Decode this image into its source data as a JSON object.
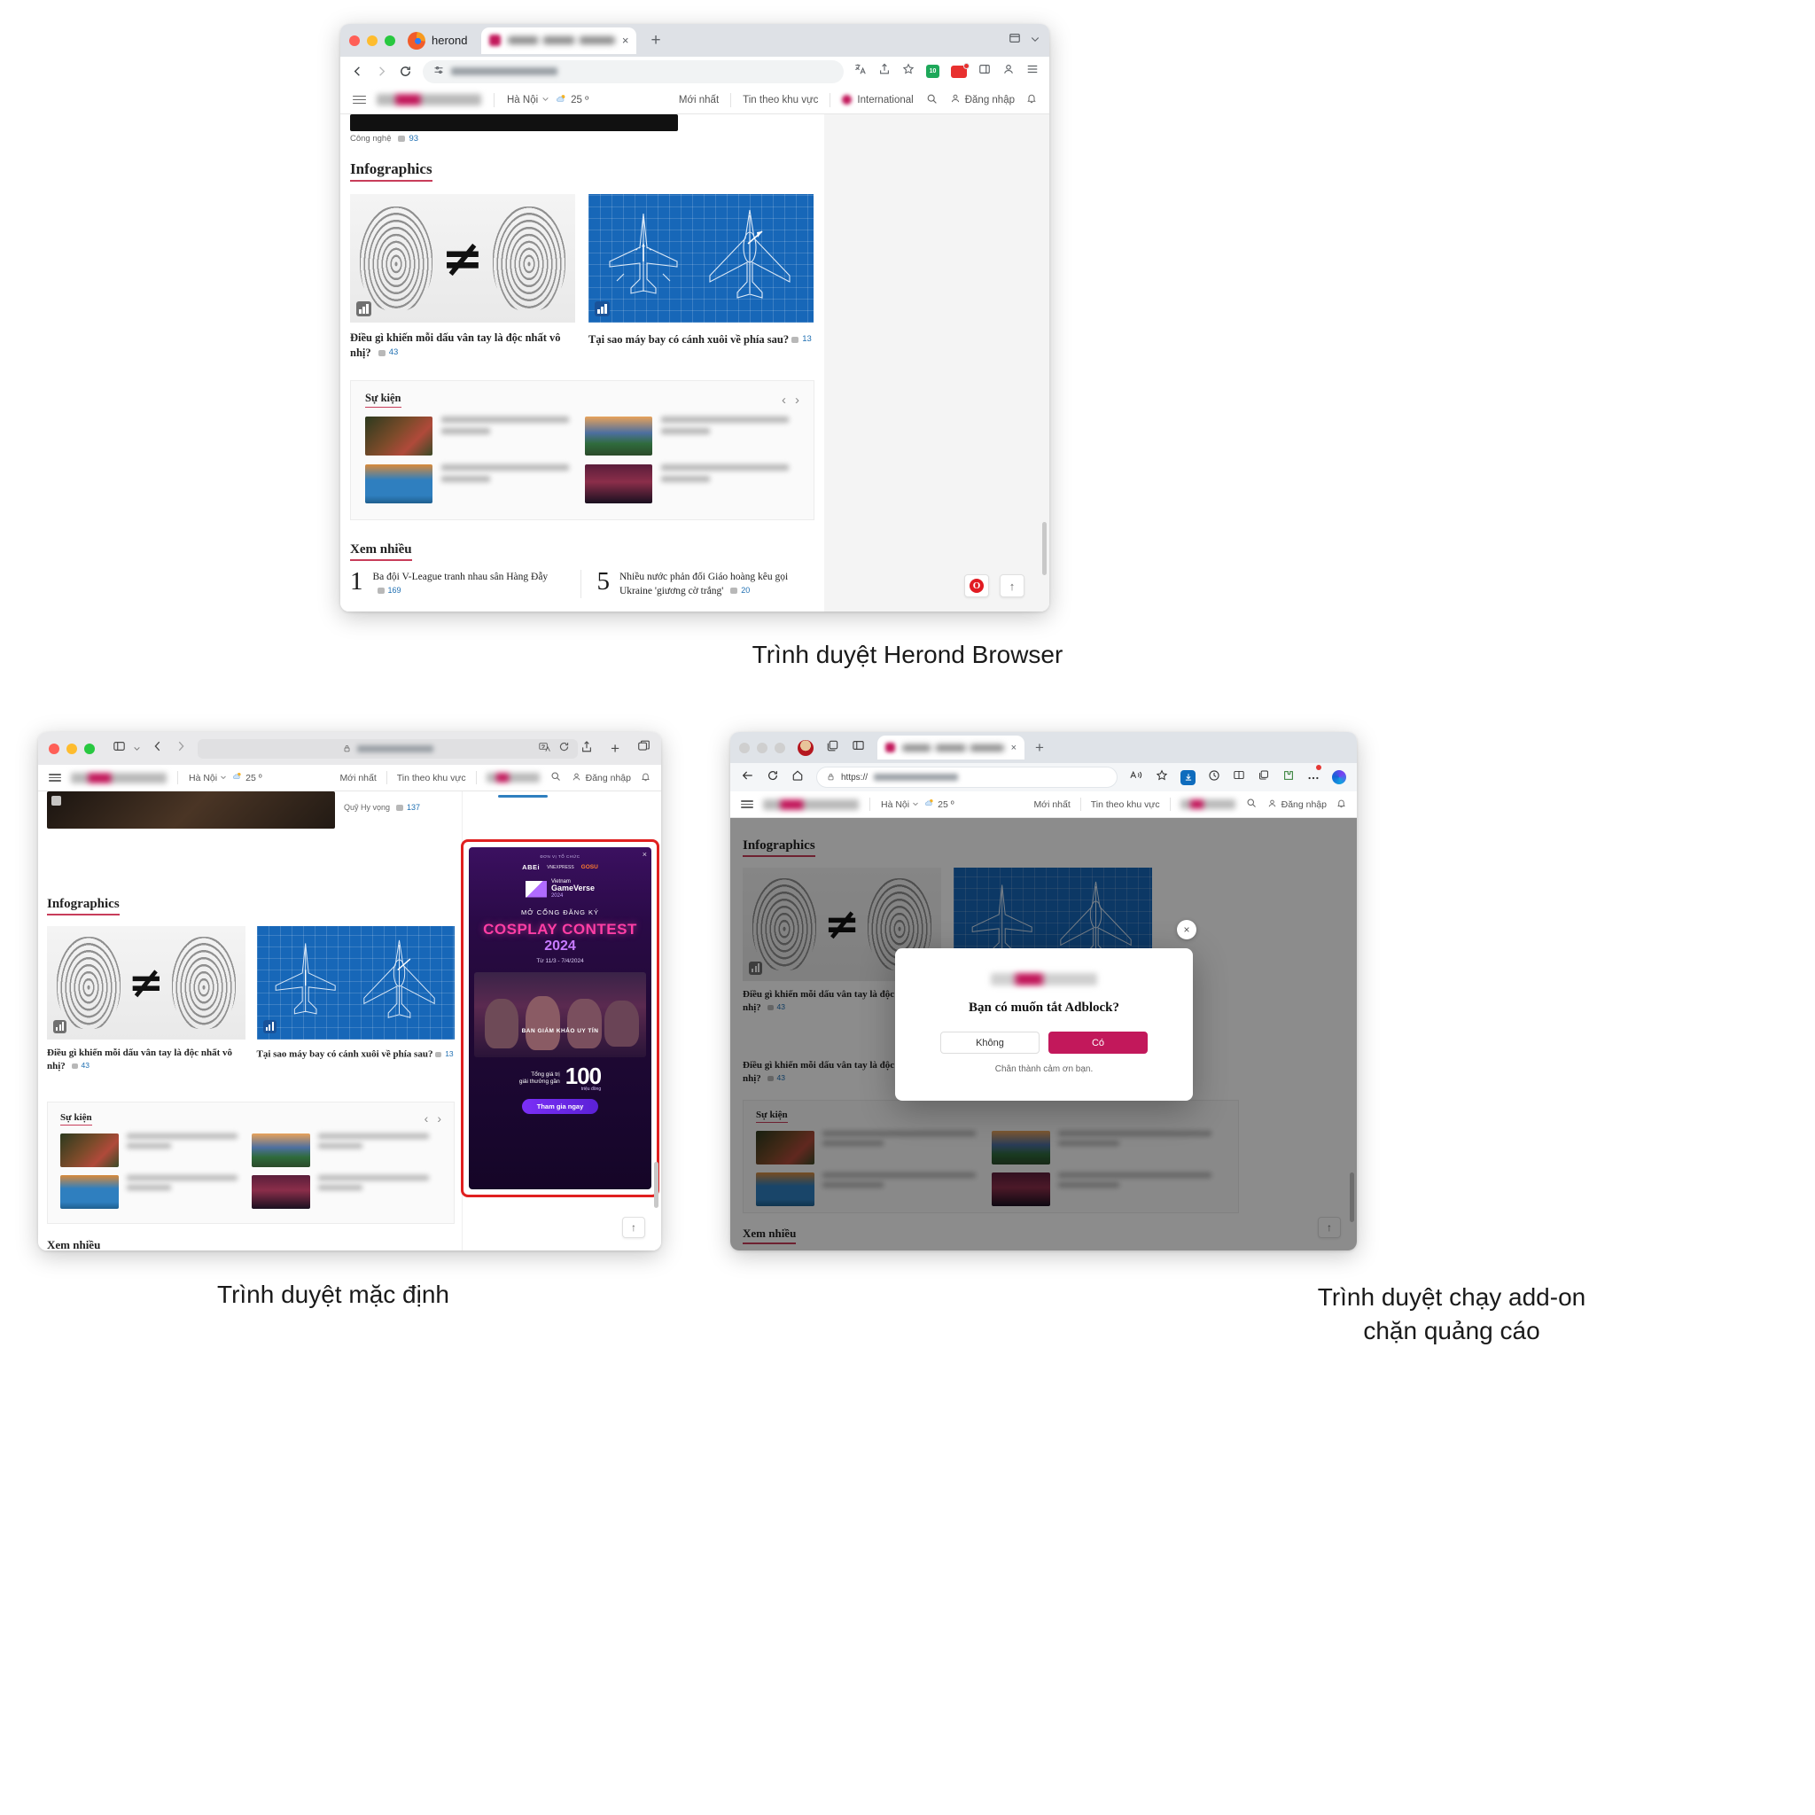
{
  "captions": {
    "top": "Trình duyệt Herond Browser",
    "bottom_left": "Trình duyệt mặc định",
    "bottom_right_line1": "Trình duyệt chạy add-on",
    "bottom_right_line2": "chặn quảng cáo"
  },
  "colors": {
    "accent_red": "#c83d5a",
    "brand_pink": "#c2185b",
    "link_blue": "#1f6fb2",
    "blueprint": "#1767b8",
    "ad_highlight": "#e02020",
    "opera_red": "#e11b22"
  },
  "browser_herond": {
    "brand_label": "herond",
    "tab_title": "",
    "tab_close": "×",
    "new_tab": "+",
    "nav": {
      "back": "←",
      "forward": "→",
      "reload": "⟳",
      "site_settings": "⚙"
    },
    "url": "",
    "toolbar_icons": [
      "translate-icon",
      "share-icon",
      "bookmark-star-icon",
      "shield-counter-icon",
      "extensions-icon",
      "sidebar-icon",
      "profile-icon",
      "menu-icon"
    ],
    "shield_count": "10",
    "window_controls": [
      "close",
      "minimize",
      "zoom"
    ]
  },
  "site": {
    "location": "Hà Nội",
    "temperature": "25 º",
    "nav_links": [
      "Mới nhất",
      "Tin theo khu vực"
    ],
    "international_label": "International",
    "login_label": "Đăng nhập",
    "search_icon": "search-icon",
    "bell_icon": "bell-icon",
    "top_snippet_category": "Công nghệ",
    "top_snippet_comments": "93",
    "quy_hy_vong_label": "Quỹ Hy vọng",
    "quy_hy_vong_comments": "137",
    "infographics": {
      "heading": "Infographics",
      "cards": [
        {
          "title": "Điều gì khiến mỗi dấu vân tay là độc nhất vô nhị?",
          "comments": "43",
          "art": "fingerprint"
        },
        {
          "title": "Tại sao máy bay có cánh xuôi về phía sau?",
          "comments": "13",
          "art": "blueprint-jet"
        }
      ]
    },
    "events": {
      "heading": "Sự kiện",
      "prev": "‹",
      "next": "›",
      "items": [
        {
          "thumb": "crowd-marathon",
          "lines": 2
        },
        {
          "thumb": "golden-bridge",
          "lines": 2
        },
        {
          "thumb": "runners-blue",
          "lines": 2
        },
        {
          "thumb": "stage-event",
          "lines": 2
        }
      ]
    },
    "most_read": {
      "heading": "Xem nhiều",
      "items": [
        {
          "rank": "1",
          "title": "Ba đội V-League tranh nhau sân Hàng Đẫy",
          "comments": "169"
        },
        {
          "rank": "5",
          "title": "Nhiều nước phản đối Giáo hoàng kêu gọi Ukraine 'giương cờ trắng'",
          "comments": "20"
        }
      ]
    },
    "back_to_top": "↑"
  },
  "browser_safari": {
    "window_controls": [
      "close",
      "minimize",
      "zoom"
    ],
    "sidebar_icon": "sidebar-icon",
    "chevron": "⌄",
    "back": "‹",
    "forward": "›",
    "lock_icon": "lock-icon",
    "url": "",
    "share_icon": "share-icon",
    "new_tab": "+",
    "tabs_icon": "tabs-overview-icon",
    "translate_icon": "translate-icon",
    "reload_icon": "reload-icon"
  },
  "ad": {
    "organizer_label": "ĐƠN VỊ TỔ CHỨC",
    "sponsors": [
      "ABEi",
      "VNEXPRESS",
      "GOSU"
    ],
    "event_brand_line1": "Vietnam",
    "event_brand_line2": "GameVerse",
    "event_year": "2024",
    "open_line": "MỞ CỔNG ĐĂNG KÝ",
    "title": "COSPLAY CONTEST",
    "title_year": "2024",
    "dates": "Từ 11/3 - 7/4/2024",
    "judges_label": "BAN GIÁM KHẢO UY TÍN",
    "prize_label_line1": "Tổng giá trị",
    "prize_label_line2": "giải thưởng gần",
    "prize_amount": "100",
    "prize_unit": "triệu đồng",
    "cta": "Tham gia ngay",
    "close": "×"
  },
  "browser_edge": {
    "window_controls": [
      "close",
      "minimize",
      "zoom"
    ],
    "avatar": "profile-avatar",
    "collections_icon": "collections-icon",
    "split_icon": "split-screen-icon",
    "tab_close": "×",
    "new_tab": "+",
    "back": "←",
    "reload": "⟳",
    "home": "⌂",
    "lock_icon": "lock-icon",
    "url_prefix": "https://",
    "toolbar_icons": [
      "read-aloud-icon",
      "favorite-star-icon",
      "downloads-icon",
      "history-icon",
      "split-screen-icon",
      "browser-essentials-icon",
      "collections-icon",
      "extensions-icon",
      "more-icon",
      "copilot-icon"
    ]
  },
  "modal": {
    "logo": "site-logo-blurred",
    "title": "Bạn có muốn tắt Adblock?",
    "decline": "Không",
    "accept": "Có",
    "note": "Chân thành cảm ơn bạn.",
    "close": "×"
  }
}
